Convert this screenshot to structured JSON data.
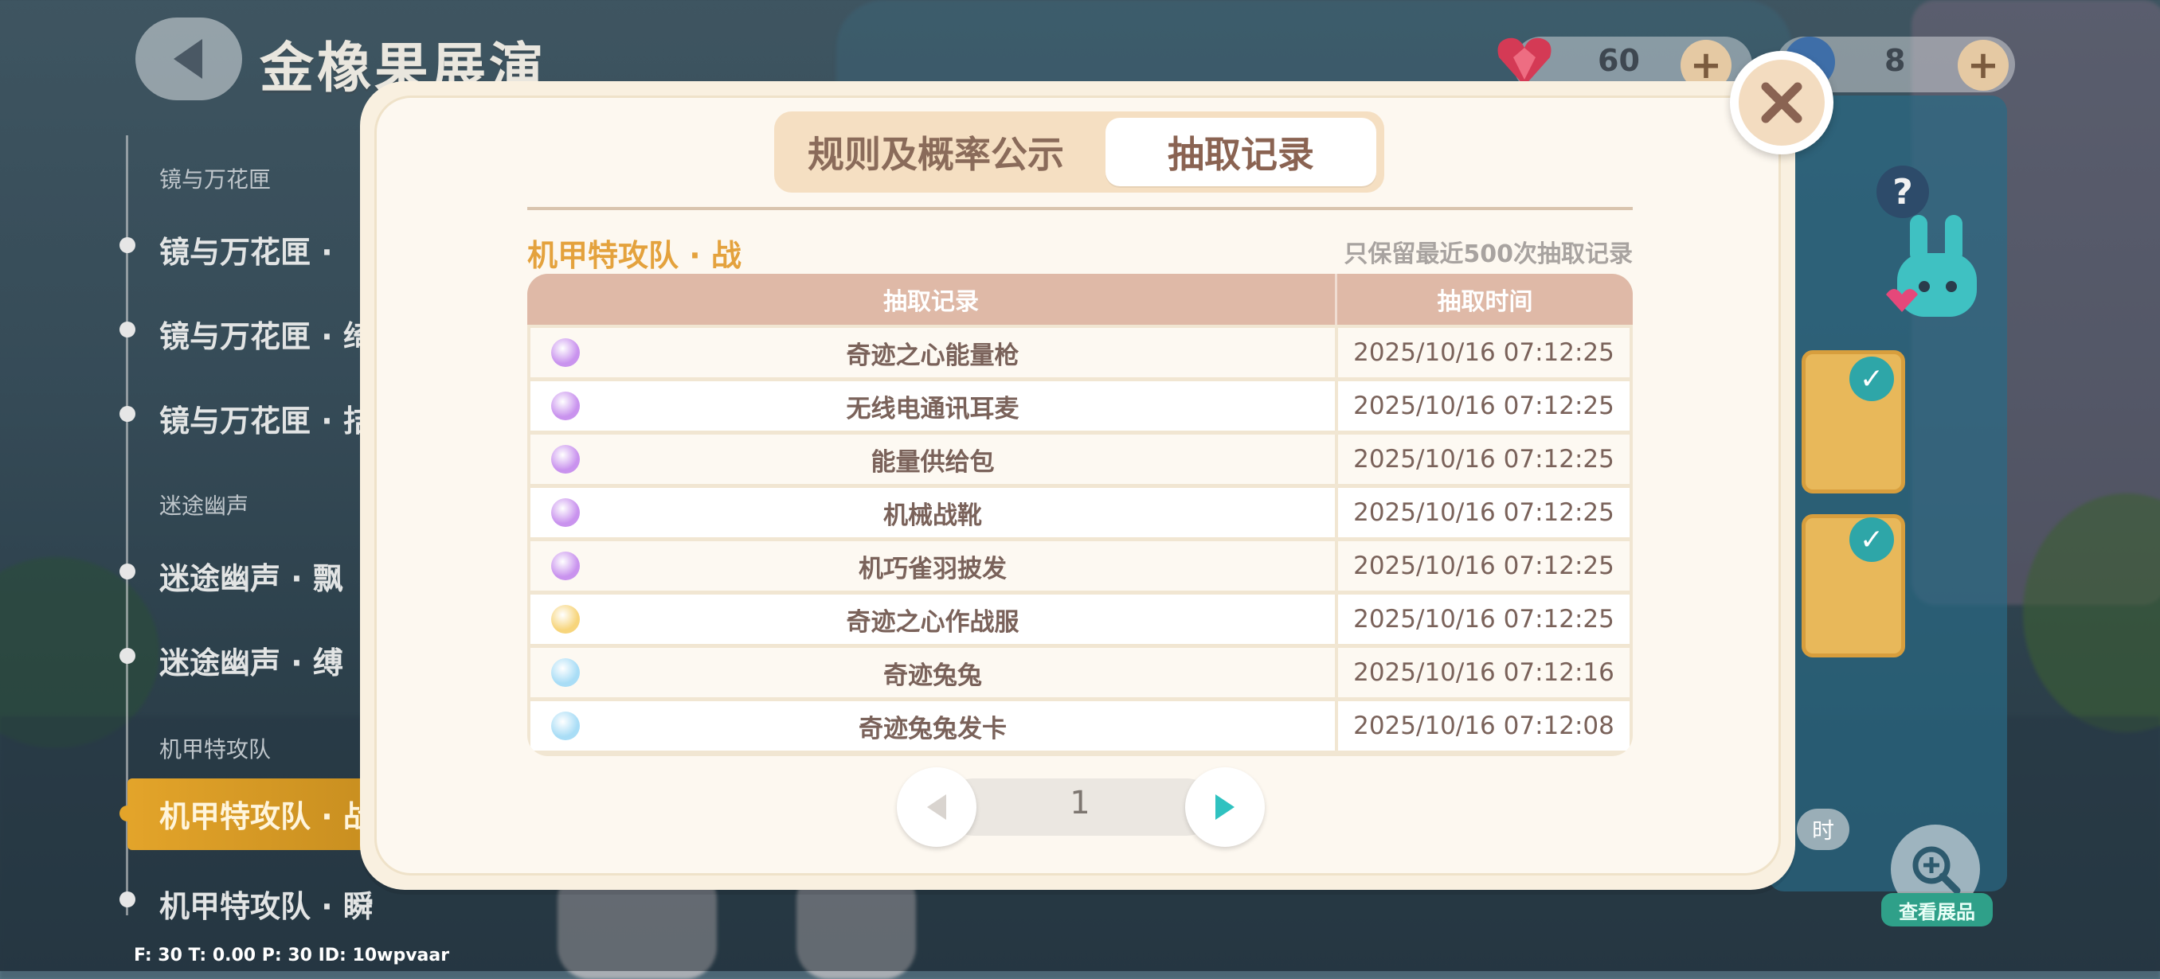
{
  "page": {
    "title": "金橡果展演",
    "debug": "F: 30   T: 0.00   P: 30   ID: 10wpvaar"
  },
  "hud": {
    "heart_count": "60",
    "blue_count": "8",
    "plus": "+"
  },
  "sidebar": {
    "sections": [
      {
        "header": "镜与万花匣",
        "items": [
          "镜与万花匣 · ",
          "镜与万花匣 · 绮",
          "镜与万花匣 · 拮"
        ]
      },
      {
        "header": "迷途幽声",
        "items": [
          "迷途幽声 · 飘",
          "迷途幽声 · 缚"
        ]
      },
      {
        "header": "机甲特攻队",
        "items": [
          "机甲特攻队 · 战",
          "机甲特攻队 · 瞬"
        ]
      }
    ]
  },
  "right_panel": {
    "help": "?",
    "view_exhibit": "查看展品",
    "side_tag": "时"
  },
  "modal": {
    "tabs": [
      {
        "label": "规则及概率公示",
        "active": false
      },
      {
        "label": "抽取记录",
        "active": true
      }
    ],
    "section_title": "机甲特攻队 · 战",
    "note": "只保留最近500次抽取记录",
    "table": {
      "headers": [
        "抽取记录",
        "抽取时间"
      ],
      "rows": [
        {
          "name": "奇迹之心能量枪",
          "time": "2025/10/16 07:12:25",
          "rarity_color": "#c993ee"
        },
        {
          "name": "无线电通讯耳麦",
          "time": "2025/10/16 07:12:25",
          "rarity_color": "#c993ee"
        },
        {
          "name": "能量供给包",
          "time": "2025/10/16 07:12:25",
          "rarity_color": "#c993ee"
        },
        {
          "name": "机械战靴",
          "time": "2025/10/16 07:12:25",
          "rarity_color": "#c993ee"
        },
        {
          "name": "机巧雀羽披发",
          "time": "2025/10/16 07:12:25",
          "rarity_color": "#c993ee"
        },
        {
          "name": "奇迹之心作战服",
          "time": "2025/10/16 07:12:25",
          "rarity_color": "#f7d57c"
        },
        {
          "name": "奇迹兔兔",
          "time": "2025/10/16 07:12:16",
          "rarity_color": "#a9ddf6"
        },
        {
          "name": "奇迹兔兔发卡",
          "time": "2025/10/16 07:12:08",
          "rarity_color": "#a9ddf6"
        }
      ]
    },
    "pager": {
      "current": "1"
    }
  },
  "colors": {
    "accent_orange": "#e4a23d",
    "table_header": "#dfb9a7",
    "pager_arrow": "#2fc2c0"
  }
}
